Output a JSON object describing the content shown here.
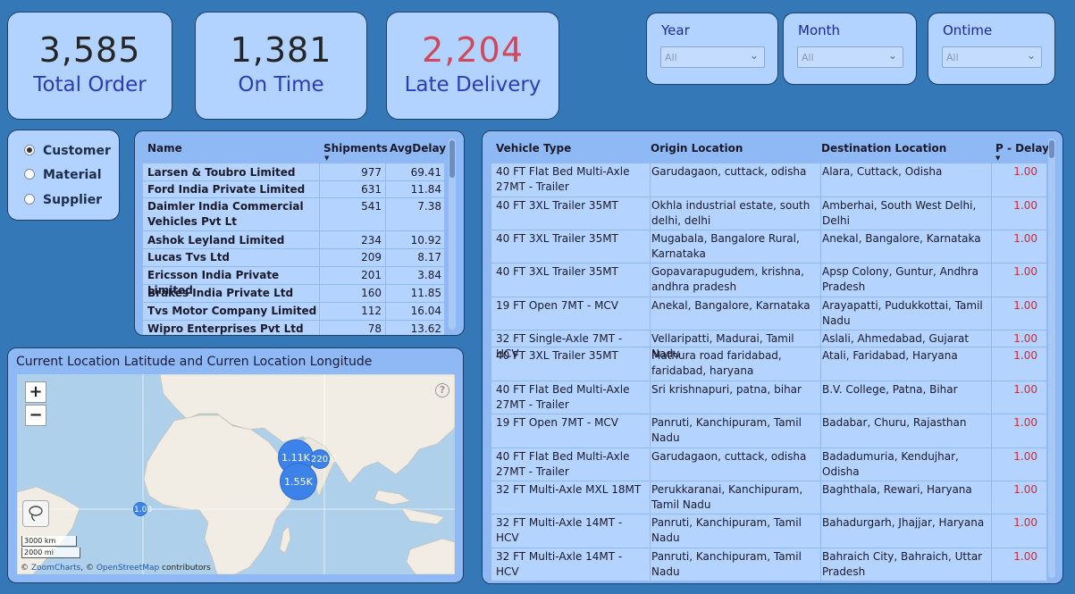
{
  "kpis": {
    "total_order": {
      "value": "3,585",
      "label": "Total Order"
    },
    "on_time": {
      "value": "1,381",
      "label": "On Time"
    },
    "late_delivery": {
      "value": "2,204",
      "label": "Late Delivery"
    }
  },
  "slicers": {
    "year": {
      "title": "Year",
      "value": "All"
    },
    "month": {
      "title": "Month",
      "value": "All"
    },
    "ontime": {
      "title": "Ontime",
      "value": "All"
    }
  },
  "radio": {
    "options": [
      "Customer",
      "Material",
      "Supplier"
    ],
    "selected": "Customer"
  },
  "customer_table": {
    "headers": [
      "Name",
      "Shipments",
      "AvgDelay"
    ],
    "rows": [
      {
        "name": "Larsen & Toubro Limited",
        "shipments": "977",
        "avgdelay": "69.41"
      },
      {
        "name": "Ford India Private Limited",
        "shipments": "631",
        "avgdelay": "11.84"
      },
      {
        "name": "Daimler India Commercial Vehicles Pvt Lt",
        "shipments": "541",
        "avgdelay": "7.38"
      },
      {
        "name": "Ashok Leyland Limited",
        "shipments": "234",
        "avgdelay": "10.92"
      },
      {
        "name": "Lucas Tvs Ltd",
        "shipments": "209",
        "avgdelay": "8.17"
      },
      {
        "name": "Ericsson India Private Limited",
        "shipments": "201",
        "avgdelay": "3.84"
      },
      {
        "name": "Brakes India Private Ltd",
        "shipments": "160",
        "avgdelay": "11.85"
      },
      {
        "name": "Tvs Motor Company Limited",
        "shipments": "112",
        "avgdelay": "16.04"
      },
      {
        "name": "Wipro Enterprises Pvt Ltd",
        "shipments": "78",
        "avgdelay": "13.62"
      }
    ]
  },
  "map": {
    "title": "Current Location Latitude and Curren Location Longitude",
    "zoom_in": "+",
    "zoom_out": "−",
    "help": "?",
    "scale_km": "3000 km",
    "scale_mi": "2000 mi",
    "attribution_prefix": "© ",
    "attribution_zoomcharts": "ZoomCharts",
    "attribution_mid": ", © ",
    "attribution_osm": "OpenStreetMap",
    "attribution_suffix": " contributors",
    "bubbles": [
      {
        "label": "1.11K"
      },
      {
        "label": "220.0"
      },
      {
        "label": "1.55K"
      },
      {
        "label": "1.00"
      }
    ]
  },
  "vehicle_table": {
    "headers": [
      "Vehicle Type",
      "Origin Location",
      "Destination Location",
      "P - Delay"
    ],
    "rows": [
      {
        "vehicle": "40 FT Flat Bed Multi-Axle 27MT - Trailer",
        "origin": "Garudagaon, cuttack, odisha",
        "dest": "Alara, Cuttack, Odisha",
        "delay": "1.00"
      },
      {
        "vehicle": "40 FT 3XL Trailer 35MT",
        "origin": "Okhla industrial estate, south delhi, delhi",
        "dest": "Amberhai, South West Delhi, Delhi",
        "delay": "1.00"
      },
      {
        "vehicle": "40 FT 3XL Trailer 35MT",
        "origin": "Mugabala, Bangalore Rural, Karnataka",
        "dest": "Anekal, Bangalore, Karnataka",
        "delay": "1.00"
      },
      {
        "vehicle": "40 FT 3XL Trailer 35MT",
        "origin": "Gopavarapugudem, krishna, andhra pradesh",
        "dest": "Apsp Colony, Guntur, Andhra Pradesh",
        "delay": "1.00"
      },
      {
        "vehicle": "19 FT Open 7MT - MCV",
        "origin": "Anekal, Bangalore, Karnataka",
        "dest": "Arayapatti, Pudukkottai, Tamil Nadu",
        "delay": "1.00"
      },
      {
        "vehicle": "32 FT Single-Axle 7MT - HCV",
        "origin": "Vellaripatti, Madurai, Tamil Nadu",
        "dest": "Aslali, Ahmedabad, Gujarat",
        "delay": "1.00"
      },
      {
        "vehicle": "40 FT 3XL Trailer 35MT",
        "origin": "Mathura road faridabad, faridabad, haryana",
        "dest": "Atali, Faridabad, Haryana",
        "delay": "1.00"
      },
      {
        "vehicle": "40 FT Flat Bed Multi-Axle 27MT - Trailer",
        "origin": "Sri krishnapuri, patna, bihar",
        "dest": "B.V. College, Patna, Bihar",
        "delay": "1.00"
      },
      {
        "vehicle": "19 FT Open 7MT - MCV",
        "origin": "Panruti, Kanchipuram, Tamil Nadu",
        "dest": "Badabar, Churu, Rajasthan",
        "delay": "1.00"
      },
      {
        "vehicle": "40 FT Flat Bed Multi-Axle 27MT - Trailer",
        "origin": "Garudagaon, cuttack, odisha",
        "dest": "Badadumuria, Kendujhar, Odisha",
        "delay": "1.00"
      },
      {
        "vehicle": "32 FT Multi-Axle MXL 18MT",
        "origin": "Perukkaranai, Kanchipuram, Tamil Nadu",
        "dest": "Baghthala, Rewari, Haryana",
        "delay": "1.00"
      },
      {
        "vehicle": "32 FT Multi-Axle 14MT - HCV",
        "origin": "Panruti, Kanchipuram, Tamil Nadu",
        "dest": "Bahadurgarh, Jhajjar, Haryana",
        "delay": "1.00"
      },
      {
        "vehicle": "32 FT Multi-Axle 14MT - HCV",
        "origin": "Panruti, Kanchipuram, Tamil Nadu",
        "dest": "Bahraich City, Bahraich, Uttar Pradesh",
        "delay": "1.00"
      }
    ]
  },
  "colors": {
    "background": "#3478b8",
    "card": "#b2d2ff",
    "late_value": "#d0485a",
    "label_blue": "#2a3cb8",
    "delay_red": "#e0242e",
    "bubble": "#3d82e8"
  }
}
